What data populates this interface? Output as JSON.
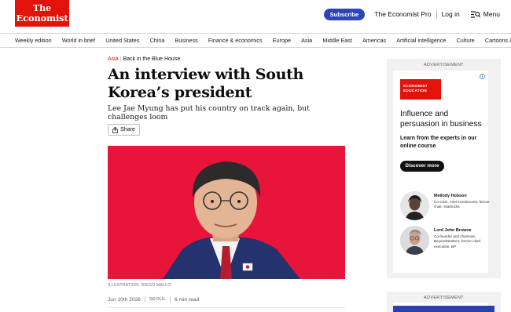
{
  "header": {
    "logo_line1": "The",
    "logo_line2": "Economist",
    "subscribe_label": "Subscribe",
    "pro_label": "The Economist Pro",
    "login_label": "Log in",
    "menu_label": "Menu"
  },
  "nav": {
    "items": [
      "Weekly edition",
      "World in brief",
      "United States",
      "China",
      "Business",
      "Finance & economics",
      "Europe",
      "Asia",
      "Middle East",
      "Americas",
      "Artificial intelligence",
      "Culture",
      "Cartoons & games"
    ]
  },
  "article": {
    "section": "Asia",
    "column": "Back in the Blue House",
    "headline": "An interview with South Korea’s president",
    "subheadline": "Lee Jae Myung has put his country on track again, but challenges loom",
    "share_label": "Share",
    "image_caption": "ILLUSTRATION: DIEGO MALLO",
    "date": "Jun 10th 2026",
    "dateline": "SEOUL",
    "read_time": "6 min read"
  },
  "ads": {
    "label": "ADVERTISEMENT",
    "badge_line1": "ECONOMIST",
    "badge_line2": "EDUCATION",
    "info_icon": "info-icon",
    "title": "Influence and persuasion in business",
    "subtitle": "Learn from the experts in our online course",
    "cta_label": "Discover more",
    "people": [
      {
        "name": "Mellody Hobson",
        "role": "Co-CEO, Ariel Investments; former chair, Starbucks"
      },
      {
        "name": "Lord John Browne",
        "role": "Co-founder and chairman, BeyondNetZero; former chief executive, BP"
      }
    ],
    "second_label": "ADVERTISEMENT"
  },
  "colors": {
    "brand_red": "#e3120b",
    "subscribe_blue": "#2e45b8",
    "hero_bg": "#e8143a"
  }
}
